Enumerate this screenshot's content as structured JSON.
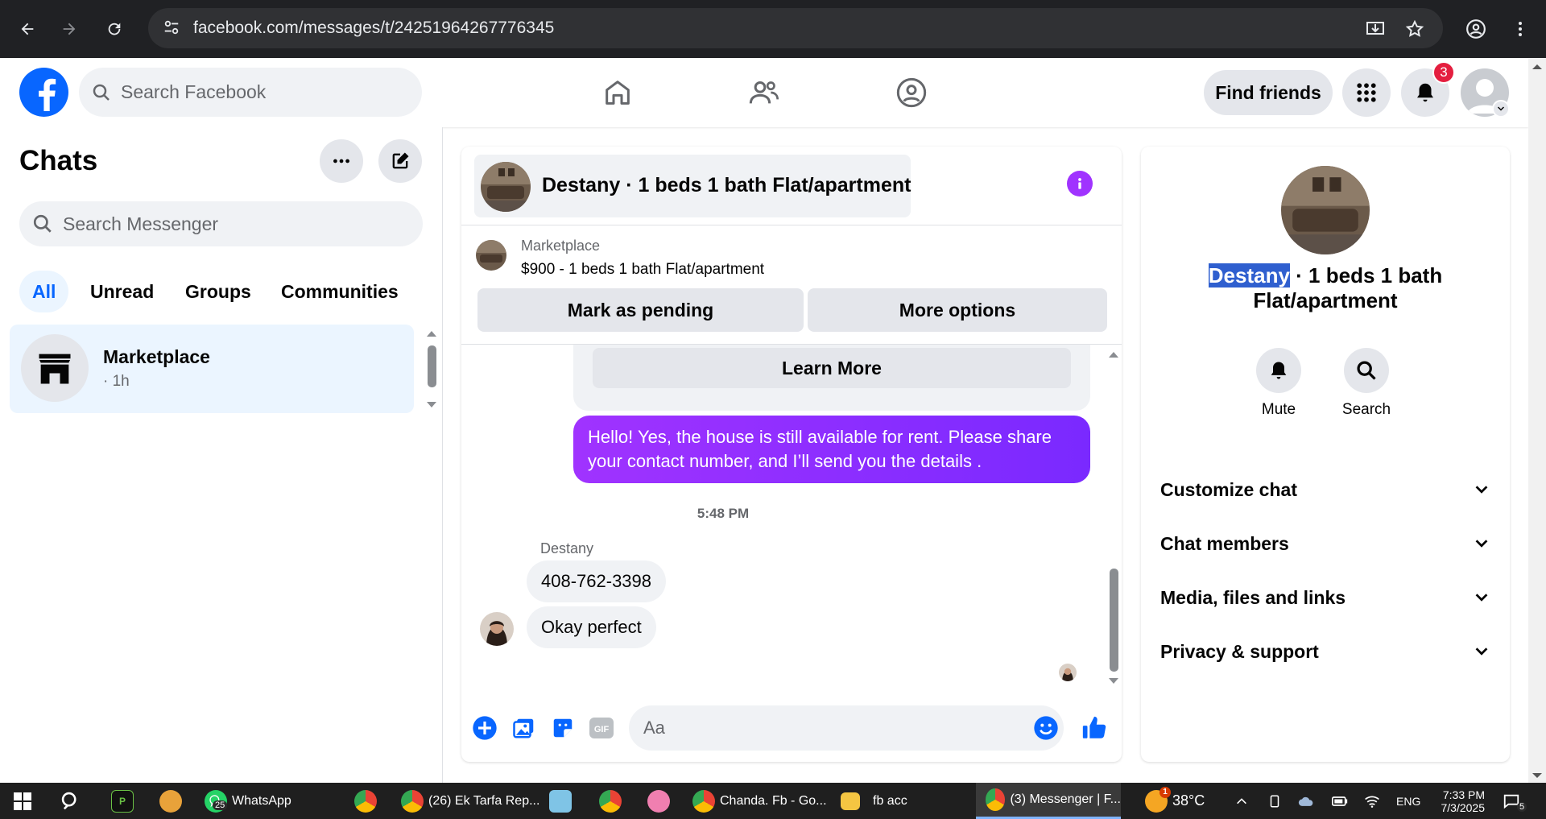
{
  "browser": {
    "url": "facebook.com/messages/t/24251964267776345"
  },
  "header": {
    "search_placeholder": "Search Facebook",
    "find_friends": "Find friends",
    "notification_count": "3"
  },
  "sidebar": {
    "title": "Chats",
    "search_placeholder": "Search Messenger",
    "filters": [
      "All",
      "Unread",
      "Groups",
      "Communities"
    ],
    "chats": [
      {
        "name": "Marketplace",
        "time": "· 1h"
      }
    ]
  },
  "conversation": {
    "title": "Destany · 1 beds 1 bath Flat/apartment",
    "marketplace_label": "Marketplace",
    "listing": "$900 - 1 beds 1 bath Flat/apartment",
    "mark_pending": "Mark as pending",
    "more_options": "More options",
    "learn_more": "Learn More",
    "outgoing_message": "Hello! Yes, the house is still available for rent. Please share your contact number, and I’ll send you the details .",
    "timestamp": "5:48 PM",
    "sender": "Destany",
    "incoming": [
      "408-762-3398",
      "Okay perfect"
    ],
    "composer_placeholder": "Aa"
  },
  "details": {
    "name_highlight": "Destany",
    "name_rest": " · 1 beds 1 bath Flat/apartment",
    "actions": [
      "Mute",
      "Search"
    ],
    "sections": [
      "Customize chat",
      "Chat members",
      "Media, files and links",
      "Privacy & support"
    ]
  },
  "taskbar": {
    "whatsapp": "WhatsApp",
    "whatsapp_badge": "25",
    "chrome1": "(26) Ek Tarfa Rep...",
    "chrome2": "Chanda. Fb - Go...",
    "folder": "fb acc",
    "chrome3": "(3) Messenger | F...",
    "weather_badge": "1",
    "temperature": "38°C",
    "language": "ENG",
    "time": "7:33 PM",
    "date": "7/3/2025",
    "notif_count": "5"
  },
  "colors": {
    "fb_blue": "#0866ff",
    "messenger_purple": "#a033ff",
    "selected_bg": "#ebf5ff"
  }
}
